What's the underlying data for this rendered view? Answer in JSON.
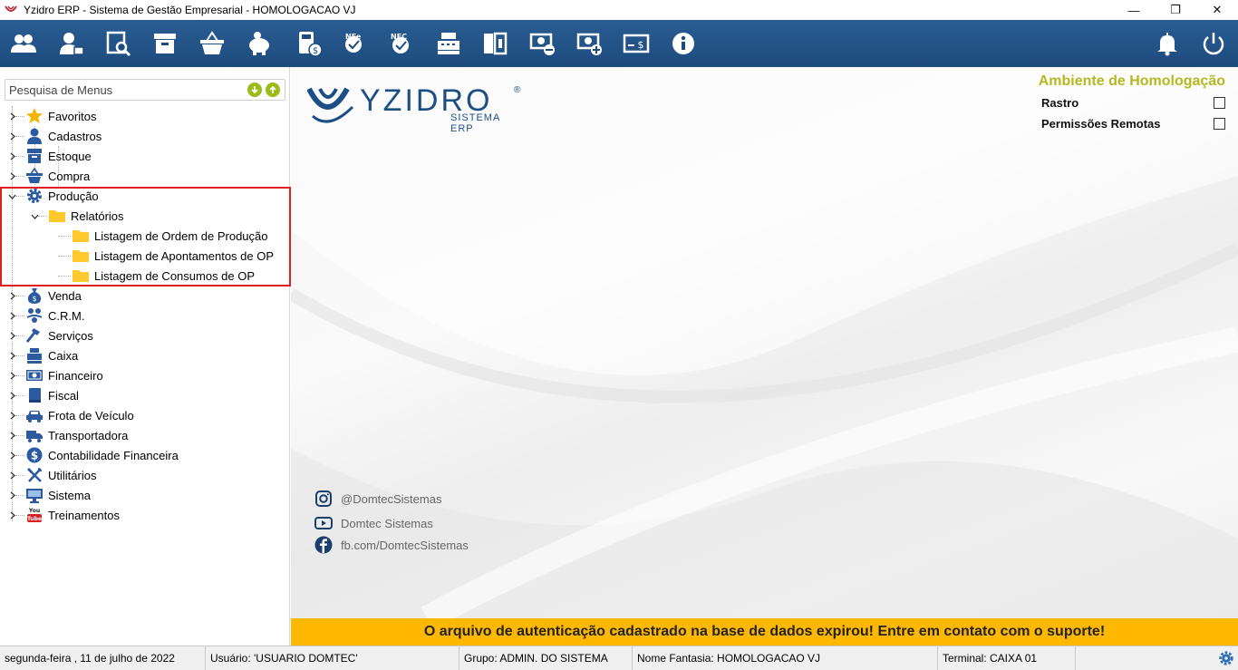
{
  "window": {
    "title": "Yzidro ERP - Sistema de Gestão Empresarial - HOMOLOGACAO VJ",
    "minimize": "—",
    "restore": "❐",
    "close": "✕"
  },
  "toolbar": {
    "icons": [
      "users-icon",
      "user-card-icon",
      "search-document-icon",
      "archive-box-icon",
      "basket-icon",
      "pig-icon",
      "calculator-money-icon",
      "nfe-icon",
      "nfce-icon",
      "cash-register-icon",
      "door-icon",
      "money-minus-icon",
      "money-plus-icon",
      "card-money-icon",
      "info-icon",
      "bell-icon",
      "power-icon"
    ]
  },
  "sidebar": {
    "search_placeholder": "Pesquisa de Menus",
    "items": [
      {
        "label": "Favoritos",
        "icon": "star-icon"
      },
      {
        "label": "Cadastros",
        "icon": "person-icon"
      },
      {
        "label": "Estoque",
        "icon": "box-icon"
      },
      {
        "label": "Compra",
        "icon": "basket-icon"
      },
      {
        "label": "Produção",
        "icon": "gear-icon",
        "expanded": true
      },
      {
        "label": "Relatórios",
        "icon": "folder-icon",
        "expanded": true
      },
      {
        "label": "Listagem de Ordem de Produção",
        "icon": "folder-icon"
      },
      {
        "label": "Listagem de Apontamentos de OP",
        "icon": "folder-icon"
      },
      {
        "label": "Listagem de Consumos de OP",
        "icon": "folder-icon"
      },
      {
        "label": "Venda",
        "icon": "money-bag-icon"
      },
      {
        "label": "C.R.M.",
        "icon": "people-icon"
      },
      {
        "label": "Serviços",
        "icon": "hammer-icon"
      },
      {
        "label": "Caixa",
        "icon": "cash-register-icon"
      },
      {
        "label": "Financeiro",
        "icon": "money-icon"
      },
      {
        "label": "Fiscal",
        "icon": "book-icon"
      },
      {
        "label": "Frota de Veículo",
        "icon": "car-icon"
      },
      {
        "label": "Transportadora",
        "icon": "truck-icon"
      },
      {
        "label": "Contabilidade Financeira",
        "icon": "dollar-coin-icon"
      },
      {
        "label": "Utilitários",
        "icon": "tools-icon"
      },
      {
        "label": "Sistema",
        "icon": "monitor-icon"
      },
      {
        "label": "Treinamentos",
        "icon": "youtube-icon"
      }
    ]
  },
  "main": {
    "logo_text": "YZIDRO",
    "logo_sub": "SISTEMA ERP",
    "logo_reg": "®",
    "environment_title": "Ambiente de Homologação",
    "options": [
      {
        "label": "Rastro",
        "checked": false
      },
      {
        "label": "Permissões Remotas",
        "checked": false
      }
    ],
    "social": [
      {
        "icon": "instagram-icon",
        "text": "@DomtecSistemas"
      },
      {
        "icon": "youtube-icon",
        "text": "Domtec Sistemas"
      },
      {
        "icon": "facebook-icon",
        "text": "fb.com/DomtecSistemas"
      }
    ]
  },
  "warning": "O arquivo de autenticação cadastrado na base de dados expirou! Entre em contato com o suporte!",
  "status": {
    "date": "segunda-feira ,  11  de  julho  de  2022",
    "user": "Usuário: 'USUARIO DOMTEC'",
    "group": "Grupo: ADMIN. DO SISTEMA",
    "company": "Nome Fantasia: HOMOLOGACAO VJ",
    "terminal": "Terminal: CAIXA 01"
  },
  "colors": {
    "toolbar": "#1d4b7e",
    "accent_green": "#9bbb17",
    "env_title": "#b5b820",
    "warning_bg": "#ffb800",
    "highlight": "#e02020"
  }
}
